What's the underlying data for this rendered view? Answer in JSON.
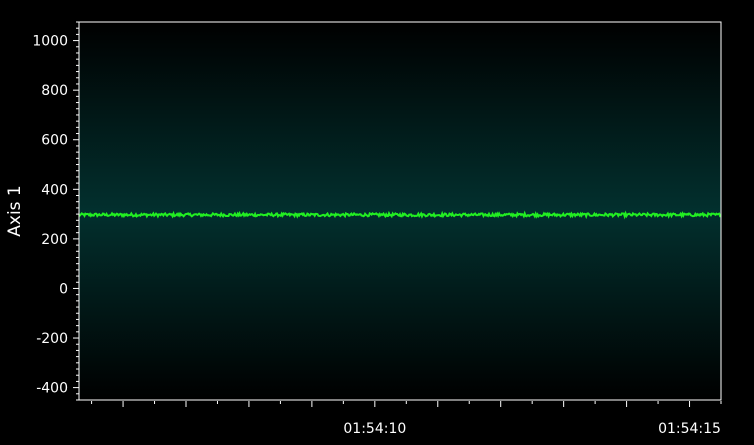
{
  "chart_data": {
    "type": "line",
    "title": "",
    "ylabel": "Axis 1",
    "xlabel": "",
    "ylim": [
      -450,
      1075
    ],
    "y_ticks": [
      1000,
      800,
      600,
      400,
      200,
      0,
      -200,
      -400
    ],
    "y_tick_labels": [
      "1000",
      "800",
      "600",
      "400",
      "200",
      "0",
      "-200",
      "-400"
    ],
    "x_range": [
      "01:54:05.3",
      "01:54:15.5"
    ],
    "x_tick_labels": [
      {
        "t": "01:54:10",
        "label": "01:54:10"
      },
      {
        "t": "01:54:15",
        "label": "01:54:15"
      }
    ],
    "series": [
      {
        "color": "#22ee22",
        "mean_value": 297,
        "noise_amplitude": 6,
        "x_start": "01:54:05.3",
        "x_end": "01:54:15.5"
      }
    ],
    "grid": false,
    "legend": "none",
    "colors": {
      "background": "#000000",
      "plot_glow": "#02302e",
      "axis": "#ffffff",
      "line": "#22ee22"
    }
  }
}
